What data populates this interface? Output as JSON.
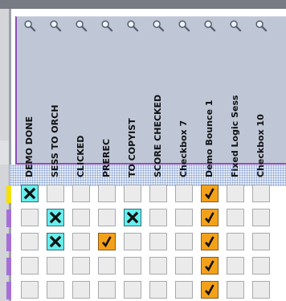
{
  "columns": [
    {
      "label": "DEMO DONE"
    },
    {
      "label": "SESS TO ORCH"
    },
    {
      "label": "CLICKED"
    },
    {
      "label": "PREREC"
    },
    {
      "label": "TO COPYIST"
    },
    {
      "label": "SCORE CHECKED"
    },
    {
      "label": "Checkbox 7"
    },
    {
      "label": "Demo Bounce 1"
    },
    {
      "label": "Fixed Logic Sess"
    },
    {
      "label": "Checkbox 10"
    }
  ],
  "rows": [
    {
      "marker_color": "#f6e000",
      "cells": [
        "x",
        "",
        "",
        "",
        "",
        "",
        "",
        "check",
        "",
        ""
      ]
    },
    {
      "marker_color": "#a66fd6",
      "cells": [
        "",
        "x",
        "",
        "",
        "x",
        "",
        "",
        "check",
        "",
        ""
      ]
    },
    {
      "marker_color": "#a66fd6",
      "cells": [
        "",
        "x",
        "",
        "check",
        "",
        "",
        "",
        "check",
        "",
        ""
      ]
    },
    {
      "marker_color": "#a66fd6",
      "cells": [
        "",
        "",
        "",
        "",
        "",
        "",
        "",
        "check",
        "",
        ""
      ]
    },
    {
      "marker_color": "#a66fd6",
      "cells": [
        "",
        "",
        "",
        "",
        "",
        "",
        "",
        "check",
        "",
        ""
      ]
    }
  ],
  "icons": {
    "column_header": "magnifier-icon",
    "cell_x": "x-mark-icon",
    "cell_check": "checkmark-icon"
  },
  "colors": {
    "x_cell": "#66eeee",
    "check_cell": "#f4a11a",
    "empty_cell": "#ebebec",
    "header_border": "#8f4fb5"
  }
}
